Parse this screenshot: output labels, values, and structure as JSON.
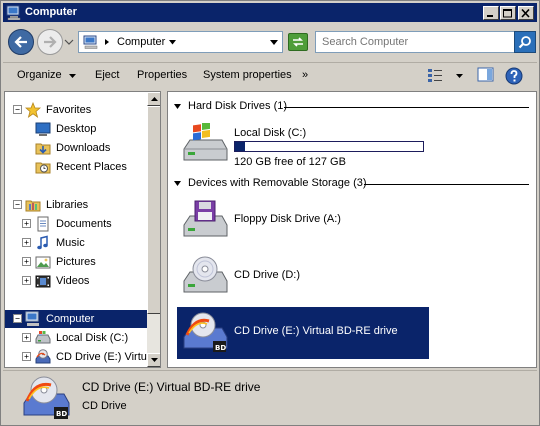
{
  "window": {
    "title": "Computer"
  },
  "address": {
    "crumb": "Computer",
    "search_placeholder": "Search Computer"
  },
  "commands": {
    "organize": "Organize",
    "eject": "Eject",
    "properties": "Properties",
    "system_properties": "System properties",
    "more": "»"
  },
  "nav": {
    "favorites": "Favorites",
    "desktop": "Desktop",
    "downloads": "Downloads",
    "recent_places": "Recent Places",
    "libraries": "Libraries",
    "documents": "Documents",
    "music": "Music",
    "pictures": "Pictures",
    "videos": "Videos",
    "computer": "Computer",
    "local_disk": "Local Disk (C:)",
    "cd_drive_e": "CD Drive (E:) Virtual BD-RE drive"
  },
  "groups": {
    "hdd": "Hard Disk Drives (1)",
    "removable": "Devices with Removable Storage (3)"
  },
  "drives": {
    "local_c": {
      "name": "Local Disk (C:)",
      "free_text": "120 GB free of 127 GB",
      "used_fraction": 0.055
    },
    "floppy": {
      "name": "Floppy Disk Drive (A:)"
    },
    "cd_d": {
      "name": "CD Drive (D:)"
    },
    "cd_e": {
      "name": "CD Drive (E:) Virtual BD-RE drive"
    }
  },
  "details": {
    "title": "CD Drive (E:) Virtual BD-RE drive",
    "subtitle": "CD Drive"
  },
  "colors": {
    "selection": "#0a246a",
    "titlebar": "#0a246a",
    "chrome": "#d4d0c8"
  }
}
